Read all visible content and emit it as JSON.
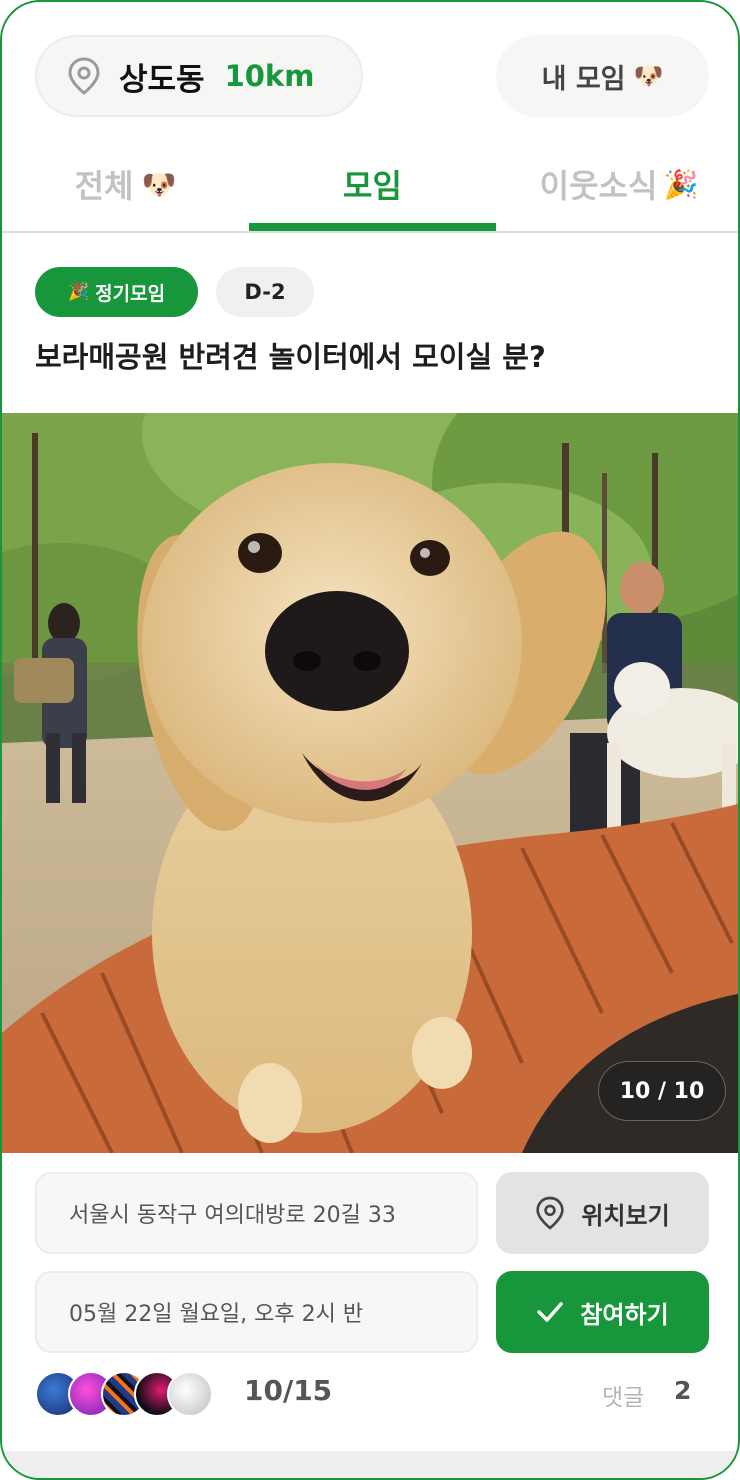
{
  "header": {
    "location_name": "상도동",
    "location_distance": "10km",
    "my_meetings_label": "내 모임",
    "my_meetings_emoji": "🐶"
  },
  "tabs": [
    {
      "label": "전체",
      "emoji": "🐶",
      "active": false
    },
    {
      "label": "모임",
      "emoji": "",
      "active": true
    },
    {
      "label": "이웃소식",
      "emoji": "🎉",
      "active": false
    }
  ],
  "post": {
    "type_badge": "정기모임",
    "type_badge_emoji": "🎉",
    "dday_badge": "D-2",
    "title": "보라매공원 반려견 놀이터에서 모이실 분?",
    "photo_description": "golden retriever puppy on wooden play ramp in park",
    "photo_counter": "10 / 10",
    "address": "서울시 동작구 여의대방로 20길 33",
    "datetime": "05월 22일 월요일, 오후 2시 반",
    "map_button_label": "위치보기",
    "join_button_label": "참여하기",
    "participants": "10/15",
    "comments_label": "댓글",
    "comments_count": "2"
  },
  "colors": {
    "accent": "#17963b",
    "inactive_tab": "#c2c2c2",
    "pill_bg": "#f6f6f5"
  },
  "icons": [
    "location-pin-icon",
    "dog-emoji-icon",
    "party-popper-icon",
    "checkmark-icon"
  ]
}
